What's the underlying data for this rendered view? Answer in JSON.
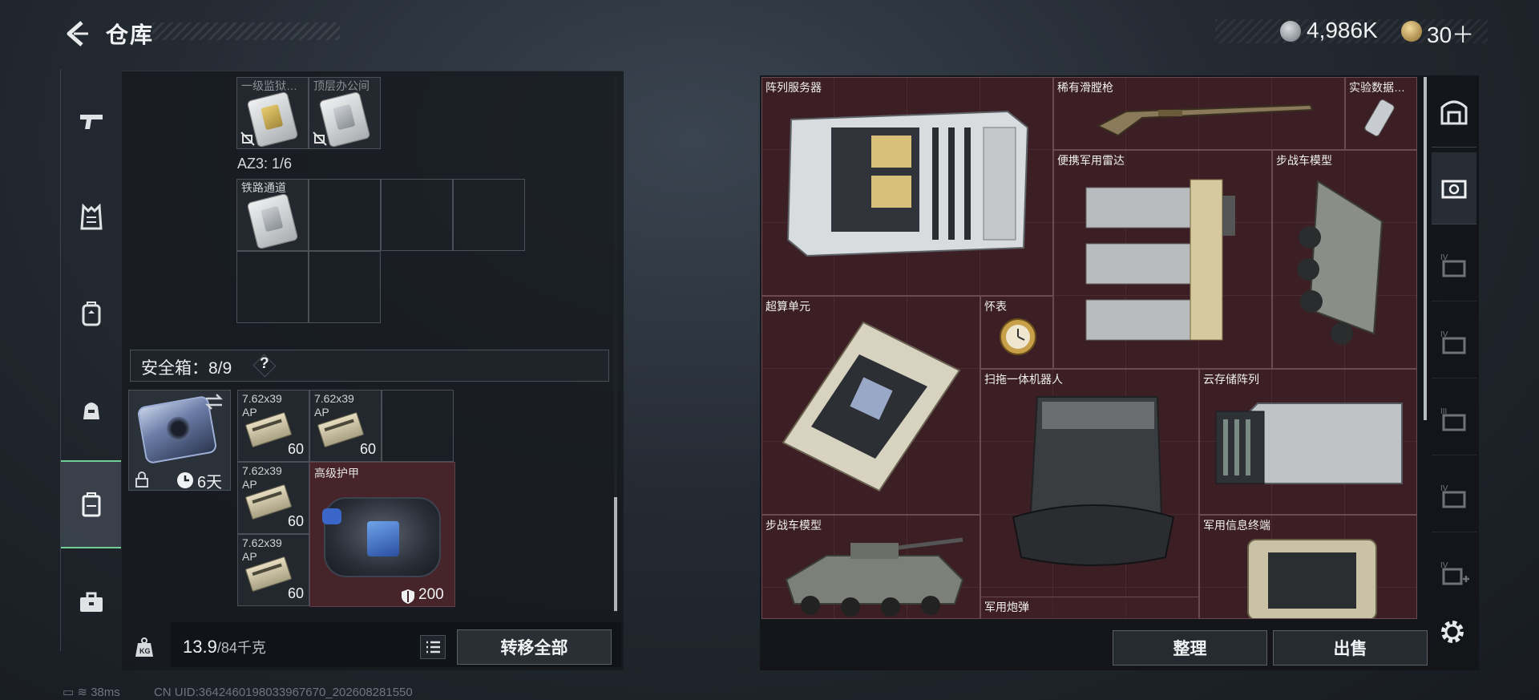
{
  "header": {
    "title": "仓库",
    "currency_silver": "4,986K",
    "currency_gold": "30＋"
  },
  "left_nav": {
    "items": [
      {
        "name": "weapons",
        "icon": "pistol-icon"
      },
      {
        "name": "vest",
        "icon": "vest-icon"
      },
      {
        "name": "backpack",
        "icon": "backpack-icon"
      },
      {
        "name": "bag",
        "icon": "pouch-icon"
      },
      {
        "name": "safe",
        "icon": "safe-case-icon",
        "active": true
      },
      {
        "name": "toolbox",
        "icon": "toolbox-icon"
      }
    ]
  },
  "inventory": {
    "cards": [
      {
        "label": "一级监狱…"
      },
      {
        "label": "顶层办公间"
      }
    ],
    "zone_label": "AZ3: 1/6",
    "rail_card": {
      "label": "铁路通道"
    },
    "safe_box": {
      "title": "安全箱：8/9",
      "help": "?",
      "duration": "6天"
    },
    "ammo": [
      {
        "label": "7.62x39",
        "sub": "AP",
        "count": "60"
      },
      {
        "label": "7.62x39",
        "sub": "AP",
        "count": "60"
      },
      {
        "label": "7.62x39",
        "sub": "AP",
        "count": "60"
      },
      {
        "label": "7.62x39",
        "sub": "AP",
        "count": "60"
      }
    ],
    "armor": {
      "label": "高级护甲",
      "durability": "200"
    },
    "weight": "13.9",
    "weight_max": "/84千克",
    "transfer_all": "转移全部"
  },
  "stash": {
    "items": [
      {
        "name": "阵列服务器"
      },
      {
        "name": "稀有滑膛枪"
      },
      {
        "name": "实验数据…"
      },
      {
        "name": "便携军用雷达"
      },
      {
        "name": "步战车模型"
      },
      {
        "name": "超算单元"
      },
      {
        "name": "怀表"
      },
      {
        "name": "扫拖一体机器人"
      },
      {
        "name": "云存储阵列"
      },
      {
        "name": "步战车模型"
      },
      {
        "name": "军用信息终端"
      },
      {
        "name": "军用炮弹"
      }
    ],
    "sort_label": "整理",
    "sell_label": "出售"
  },
  "right_nav": {
    "items": [
      {
        "name": "stash-home",
        "icon": "vault-icon"
      },
      {
        "name": "page-current",
        "icon": "page-icon"
      },
      {
        "name": "page-iv-a",
        "icon": "page-iv-icon"
      },
      {
        "name": "page-iv-b",
        "icon": "page-iv-icon"
      },
      {
        "name": "page-iii",
        "icon": "page-iii-icon"
      },
      {
        "name": "page-iv-c",
        "icon": "page-iv-icon"
      },
      {
        "name": "page-add",
        "icon": "add-page-icon"
      }
    ]
  },
  "status_bar": {
    "ping": "38ms",
    "uid": "CN UID:3642460198033967670_202608281550"
  },
  "colors": {
    "accent_green": "#6fcf97",
    "grid_red": "#3b2025"
  }
}
